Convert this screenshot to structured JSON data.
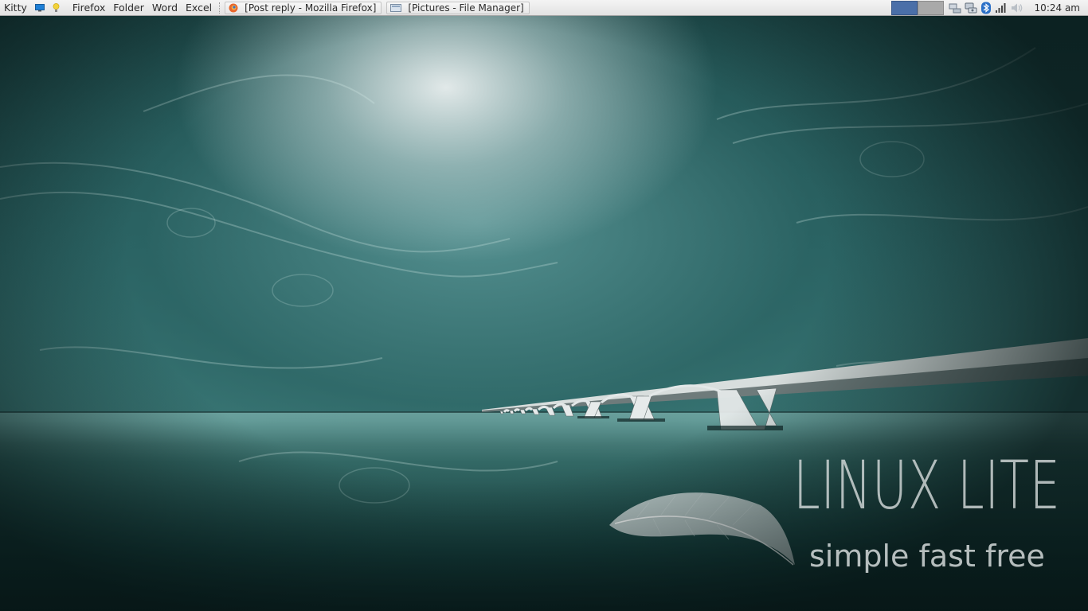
{
  "panel": {
    "launchers": [
      {
        "label": "Kitty",
        "icon": "kitty-menu"
      },
      {
        "label": "",
        "icon": "desktop-icon"
      },
      {
        "label": "",
        "icon": "bulb-icon"
      },
      {
        "label": "Firefox",
        "icon": ""
      },
      {
        "label": "Folder",
        "icon": ""
      },
      {
        "label": "Word",
        "icon": ""
      },
      {
        "label": "Excel",
        "icon": ""
      }
    ],
    "tasks": [
      {
        "label": "[Post reply - Mozilla Firefox]",
        "icon": "firefox-icon"
      },
      {
        "label": "[Pictures - File Manager]",
        "icon": "file-manager-icon"
      }
    ],
    "workspaces": [
      {
        "active": true,
        "color": "#4a6fa8"
      },
      {
        "active": false,
        "color": "#a9a9a9"
      }
    ],
    "tray": [
      "network-wired-icon",
      "network-wired-icon-2",
      "bluetooth-icon",
      "signal-strength-icon",
      "volume-muted-icon"
    ],
    "clock": "10:24 am"
  },
  "wallpaper": {
    "title": "LINUX LITE",
    "tagline": "simple fast free",
    "colors": {
      "sky_light": "#dfe8e8",
      "teal": "#3f7e7c",
      "dark": "#0f2c2c"
    }
  }
}
